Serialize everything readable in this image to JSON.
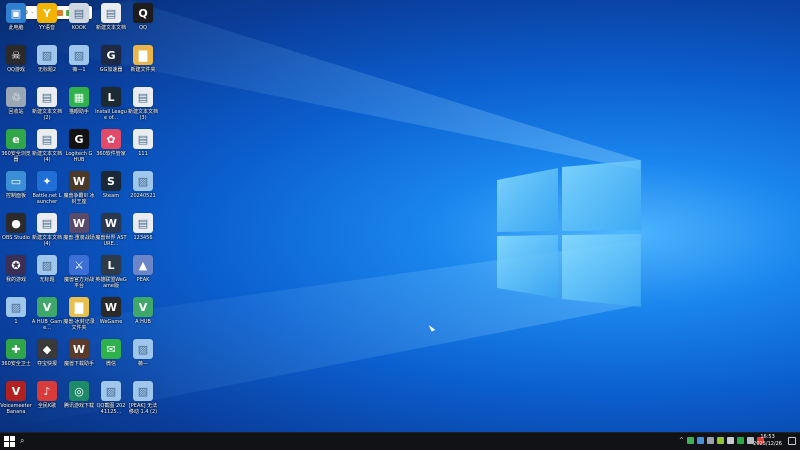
{
  "ime": {
    "label": "中"
  },
  "desktop_icons": [
    {
      "label": "此电脑",
      "color": "#2f7fd1",
      "glyph": "▣",
      "icon": "computer-icon"
    },
    {
      "label": "YY语音",
      "color": "#f2b400",
      "glyph": "Y",
      "icon": "yy-icon"
    },
    {
      "label": "KOOK",
      "color": "#cfd7e3",
      "glyph": "▤",
      "icon": "document-icon"
    },
    {
      "label": "新建文本文档",
      "color": "#e9edf2",
      "glyph": "▤",
      "icon": "text-file-icon"
    },
    {
      "label": "QQ",
      "color": "#1d1d1d",
      "glyph": "Q",
      "icon": "qq-icon"
    },
    {
      "label": "QQ游戏",
      "color": "#2a2a2a",
      "glyph": "☠",
      "icon": "qq-game-icon"
    },
    {
      "label": "无标题2",
      "color": "#9fc7ee",
      "glyph": "▨",
      "icon": "image-icon"
    },
    {
      "label": "薇—1",
      "color": "#9fc7ee",
      "glyph": "▨",
      "icon": "image-icon"
    },
    {
      "label": "GG加速器",
      "color": "#1e2a44",
      "glyph": "G",
      "icon": "gg-icon"
    },
    {
      "label": "新建文件夹",
      "color": "#e8b64b",
      "glyph": "▇",
      "icon": "folder-icon"
    },
    {
      "label": "回收站",
      "color": "#9aa8b6",
      "glyph": "♲",
      "icon": "recycle-bin-icon"
    },
    {
      "label": "新建文本文档 (2)",
      "color": "#e9edf2",
      "glyph": "▤",
      "icon": "text-file-icon"
    },
    {
      "label": "猫眼助手",
      "color": "#2fb24b",
      "glyph": "▦",
      "icon": "app-icon"
    },
    {
      "label": "Install League of...",
      "color": "#1c2a34",
      "glyph": "L",
      "icon": "league-icon"
    },
    {
      "label": "新建文本文档 (3)",
      "color": "#e9edf2",
      "glyph": "▤",
      "icon": "text-file-icon"
    },
    {
      "label": "360安全浏览器",
      "color": "#2fa748",
      "glyph": "e",
      "icon": "browser-icon"
    },
    {
      "label": "新建文本文档 (4)",
      "color": "#e9edf2",
      "glyph": "▤",
      "icon": "text-file-icon"
    },
    {
      "label": "Logitech G HUB",
      "color": "#121212",
      "glyph": "G",
      "icon": "logitech-icon"
    },
    {
      "label": "360软件管家",
      "color": "#e34a6a",
      "glyph": "✿",
      "icon": "software-manager-icon"
    },
    {
      "label": "111",
      "color": "#e9edf2",
      "glyph": "▤",
      "icon": "text-file-icon"
    },
    {
      "label": "控制面板",
      "color": "#3a8fd6",
      "glyph": "▭",
      "icon": "control-panel-icon"
    },
    {
      "label": "Battle.net Launcher",
      "color": "#1f6fd6",
      "glyph": "✦",
      "icon": "battlenet-icon"
    },
    {
      "label": "魔兽争霸III 冰封王座",
      "color": "#4b3a2a",
      "glyph": "W",
      "icon": "warcraft-icon"
    },
    {
      "label": "Steam",
      "color": "#1b2838",
      "glyph": "S",
      "icon": "steam-icon"
    },
    {
      "label": "20240521",
      "color": "#9fc7ee",
      "glyph": "▨",
      "icon": "image-icon"
    },
    {
      "label": "OBS Studio",
      "color": "#2b2b2b",
      "glyph": "●",
      "icon": "obs-icon"
    },
    {
      "label": "新建文本文档 (4)",
      "color": "#e9edf2",
      "glyph": "▤",
      "icon": "text-file-icon"
    },
    {
      "label": "魔兽·重装战场",
      "color": "#5a4a6a",
      "glyph": "W",
      "icon": "warcraft-icon"
    },
    {
      "label": "魔兽世界 ASTURE...",
      "color": "#2a3850",
      "glyph": "W",
      "icon": "wow-icon"
    },
    {
      "label": "123456",
      "color": "#e9edf2",
      "glyph": "▤",
      "icon": "text-file-icon"
    },
    {
      "label": "我的游戏",
      "color": "#3a2f55",
      "glyph": "✪",
      "icon": "game-icon"
    },
    {
      "label": "无标题",
      "color": "#9fc7ee",
      "glyph": "▨",
      "icon": "image-icon"
    },
    {
      "label": "魔兽官方对战平台",
      "color": "#3b6fd6",
      "glyph": "⚔",
      "icon": "platform-icon"
    },
    {
      "label": "英雄联盟WeGame版",
      "color": "#2c3a4a",
      "glyph": "L",
      "icon": "league-icon"
    },
    {
      "label": "PEAK",
      "color": "#6a86c8",
      "glyph": "▲",
      "icon": "peak-icon"
    },
    {
      "label": "1",
      "color": "#9fc7ee",
      "glyph": "▨",
      "icon": "image-icon"
    },
    {
      "label": "A HUB_Game...",
      "color": "#3ea86b",
      "glyph": "V",
      "icon": "vuppo-icon"
    },
    {
      "label": "魔兽·冰封记录文件夹",
      "color": "#e8c04b",
      "glyph": "▇",
      "icon": "folder-icon"
    },
    {
      "label": "WeGame",
      "color": "#2a2a2a",
      "glyph": "W",
      "icon": "wegame-icon"
    },
    {
      "label": "A HUB",
      "color": "#3ea86b",
      "glyph": "V",
      "icon": "vuppo-icon"
    },
    {
      "label": "360安全卫士",
      "color": "#2fa748",
      "glyph": "✚",
      "icon": "security-guard-icon"
    },
    {
      "label": "夺宝快报",
      "color": "#3a3a3a",
      "glyph": "◆",
      "icon": "app-icon"
    },
    {
      "label": "魔兽下载助手",
      "color": "#5a3a2a",
      "glyph": "W",
      "icon": "download-icon"
    },
    {
      "label": "微信",
      "color": "#2fb24b",
      "glyph": "✉",
      "icon": "wechat-icon"
    },
    {
      "label": "薇—",
      "color": "#9fc7ee",
      "glyph": "▨",
      "icon": "image-icon"
    },
    {
      "label": "Voicemeeter Banana",
      "color": "#b22020",
      "glyph": "V",
      "icon": "voicemeeter-icon"
    },
    {
      "label": "全民K歌",
      "color": "#d93a3a",
      "glyph": "♪",
      "icon": "karaoke-icon"
    },
    {
      "label": "腾讯游戏下载",
      "color": "#1f8a6a",
      "glyph": "◎",
      "icon": "game-download-icon"
    },
    {
      "label": "QQ截图 20241125...",
      "color": "#9fc7ee",
      "glyph": "▨",
      "icon": "image-icon"
    },
    {
      "label": "[PEAK] 无法移动 1.4 (2)",
      "color": "#9fc7ee",
      "glyph": "▨",
      "icon": "image-icon"
    }
  ],
  "clock": {
    "time": "16:53",
    "date": "2025/12/26"
  }
}
